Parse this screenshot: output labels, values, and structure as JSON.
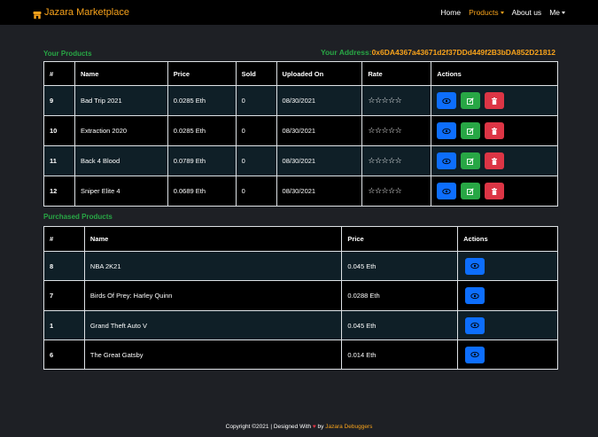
{
  "nav": {
    "brand": "Jazara Marketplace",
    "links": [
      {
        "label": "Home",
        "active": false,
        "dropdown": false
      },
      {
        "label": "Products",
        "active": true,
        "dropdown": true
      },
      {
        "label": "About us",
        "active": false,
        "dropdown": false
      },
      {
        "label": "Me",
        "active": false,
        "dropdown": true
      }
    ]
  },
  "your_products": {
    "title": "Your Products",
    "address_label": "Your Address:",
    "address_value": "0x6DA4367a43671d2f37DDd449f2B3bDA852D21812",
    "headers": [
      "#",
      "Name",
      "Price",
      "Sold",
      "Uploaded On",
      "Rate",
      "Actions"
    ],
    "rows": [
      {
        "id": "9",
        "name": "Bad Trip 2021",
        "price": "0.0285 Eth",
        "sold": "0",
        "uploaded": "08/30/2021",
        "rate": "☆☆☆☆☆"
      },
      {
        "id": "10",
        "name": "Extraction 2020",
        "price": "0.0285 Eth",
        "sold": "0",
        "uploaded": "08/30/2021",
        "rate": "☆☆☆☆☆"
      },
      {
        "id": "11",
        "name": "Back 4 Blood",
        "price": "0.0789 Eth",
        "sold": "0",
        "uploaded": "08/30/2021",
        "rate": "☆☆☆☆☆"
      },
      {
        "id": "12",
        "name": "Sniper Elite 4",
        "price": "0.0689 Eth",
        "sold": "0",
        "uploaded": "08/30/2021",
        "rate": "☆☆☆☆☆"
      }
    ]
  },
  "purchased_products": {
    "title": "Purchased Products",
    "headers": [
      "#",
      "Name",
      "Price",
      "Actions"
    ],
    "rows": [
      {
        "id": "8",
        "name": "NBA 2K21",
        "price": "0.045 Eth"
      },
      {
        "id": "7",
        "name": "Birds Of Prey: Harley Quinn",
        "price": "0.0288 Eth"
      },
      {
        "id": "1",
        "name": "Grand Theft Auto V",
        "price": "0.045 Eth"
      },
      {
        "id": "6",
        "name": "The Great Gatsby",
        "price": "0.014 Eth"
      }
    ]
  },
  "footer": {
    "text_before": "Copyright ©2021 | Designed With ",
    "heart": "♥",
    "text_by": " by ",
    "team": "Jazara Debuggers"
  },
  "icons": {
    "brand": "shop-icon",
    "view": "eye-icon",
    "edit": "edit-icon",
    "delete": "trash-icon"
  },
  "colors": {
    "accent": "#f7a21b",
    "success": "#28a745",
    "primary": "#0d6efd",
    "danger": "#dc3545",
    "background": "#1e2025"
  }
}
